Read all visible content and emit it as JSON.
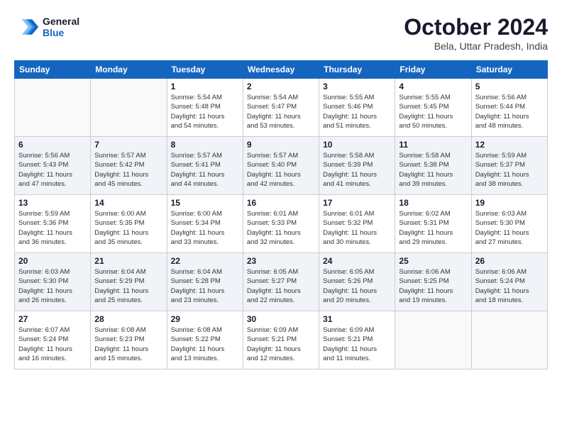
{
  "header": {
    "logo_line1": "General",
    "logo_line2": "Blue",
    "month": "October 2024",
    "location": "Bela, Uttar Pradesh, India"
  },
  "weekdays": [
    "Sunday",
    "Monday",
    "Tuesday",
    "Wednesday",
    "Thursday",
    "Friday",
    "Saturday"
  ],
  "weeks": [
    [
      {
        "day": "",
        "detail": ""
      },
      {
        "day": "",
        "detail": ""
      },
      {
        "day": "1",
        "detail": "Sunrise: 5:54 AM\nSunset: 5:48 PM\nDaylight: 11 hours\nand 54 minutes."
      },
      {
        "day": "2",
        "detail": "Sunrise: 5:54 AM\nSunset: 5:47 PM\nDaylight: 11 hours\nand 53 minutes."
      },
      {
        "day": "3",
        "detail": "Sunrise: 5:55 AM\nSunset: 5:46 PM\nDaylight: 11 hours\nand 51 minutes."
      },
      {
        "day": "4",
        "detail": "Sunrise: 5:55 AM\nSunset: 5:45 PM\nDaylight: 11 hours\nand 50 minutes."
      },
      {
        "day": "5",
        "detail": "Sunrise: 5:56 AM\nSunset: 5:44 PM\nDaylight: 11 hours\nand 48 minutes."
      }
    ],
    [
      {
        "day": "6",
        "detail": "Sunrise: 5:56 AM\nSunset: 5:43 PM\nDaylight: 11 hours\nand 47 minutes."
      },
      {
        "day": "7",
        "detail": "Sunrise: 5:57 AM\nSunset: 5:42 PM\nDaylight: 11 hours\nand 45 minutes."
      },
      {
        "day": "8",
        "detail": "Sunrise: 5:57 AM\nSunset: 5:41 PM\nDaylight: 11 hours\nand 44 minutes."
      },
      {
        "day": "9",
        "detail": "Sunrise: 5:57 AM\nSunset: 5:40 PM\nDaylight: 11 hours\nand 42 minutes."
      },
      {
        "day": "10",
        "detail": "Sunrise: 5:58 AM\nSunset: 5:39 PM\nDaylight: 11 hours\nand 41 minutes."
      },
      {
        "day": "11",
        "detail": "Sunrise: 5:58 AM\nSunset: 5:38 PM\nDaylight: 11 hours\nand 39 minutes."
      },
      {
        "day": "12",
        "detail": "Sunrise: 5:59 AM\nSunset: 5:37 PM\nDaylight: 11 hours\nand 38 minutes."
      }
    ],
    [
      {
        "day": "13",
        "detail": "Sunrise: 5:59 AM\nSunset: 5:36 PM\nDaylight: 11 hours\nand 36 minutes."
      },
      {
        "day": "14",
        "detail": "Sunrise: 6:00 AM\nSunset: 5:35 PM\nDaylight: 11 hours\nand 35 minutes."
      },
      {
        "day": "15",
        "detail": "Sunrise: 6:00 AM\nSunset: 5:34 PM\nDaylight: 11 hours\nand 33 minutes."
      },
      {
        "day": "16",
        "detail": "Sunrise: 6:01 AM\nSunset: 5:33 PM\nDaylight: 11 hours\nand 32 minutes."
      },
      {
        "day": "17",
        "detail": "Sunrise: 6:01 AM\nSunset: 5:32 PM\nDaylight: 11 hours\nand 30 minutes."
      },
      {
        "day": "18",
        "detail": "Sunrise: 6:02 AM\nSunset: 5:31 PM\nDaylight: 11 hours\nand 29 minutes."
      },
      {
        "day": "19",
        "detail": "Sunrise: 6:03 AM\nSunset: 5:30 PM\nDaylight: 11 hours\nand 27 minutes."
      }
    ],
    [
      {
        "day": "20",
        "detail": "Sunrise: 6:03 AM\nSunset: 5:30 PM\nDaylight: 11 hours\nand 26 minutes."
      },
      {
        "day": "21",
        "detail": "Sunrise: 6:04 AM\nSunset: 5:29 PM\nDaylight: 11 hours\nand 25 minutes."
      },
      {
        "day": "22",
        "detail": "Sunrise: 6:04 AM\nSunset: 5:28 PM\nDaylight: 11 hours\nand 23 minutes."
      },
      {
        "day": "23",
        "detail": "Sunrise: 6:05 AM\nSunset: 5:27 PM\nDaylight: 11 hours\nand 22 minutes."
      },
      {
        "day": "24",
        "detail": "Sunrise: 6:05 AM\nSunset: 5:26 PM\nDaylight: 11 hours\nand 20 minutes."
      },
      {
        "day": "25",
        "detail": "Sunrise: 6:06 AM\nSunset: 5:25 PM\nDaylight: 11 hours\nand 19 minutes."
      },
      {
        "day": "26",
        "detail": "Sunrise: 6:06 AM\nSunset: 5:24 PM\nDaylight: 11 hours\nand 18 minutes."
      }
    ],
    [
      {
        "day": "27",
        "detail": "Sunrise: 6:07 AM\nSunset: 5:24 PM\nDaylight: 11 hours\nand 16 minutes."
      },
      {
        "day": "28",
        "detail": "Sunrise: 6:08 AM\nSunset: 5:23 PM\nDaylight: 11 hours\nand 15 minutes."
      },
      {
        "day": "29",
        "detail": "Sunrise: 6:08 AM\nSunset: 5:22 PM\nDaylight: 11 hours\nand 13 minutes."
      },
      {
        "day": "30",
        "detail": "Sunrise: 6:09 AM\nSunset: 5:21 PM\nDaylight: 11 hours\nand 12 minutes."
      },
      {
        "day": "31",
        "detail": "Sunrise: 6:09 AM\nSunset: 5:21 PM\nDaylight: 11 hours\nand 11 minutes."
      },
      {
        "day": "",
        "detail": ""
      },
      {
        "day": "",
        "detail": ""
      }
    ]
  ]
}
